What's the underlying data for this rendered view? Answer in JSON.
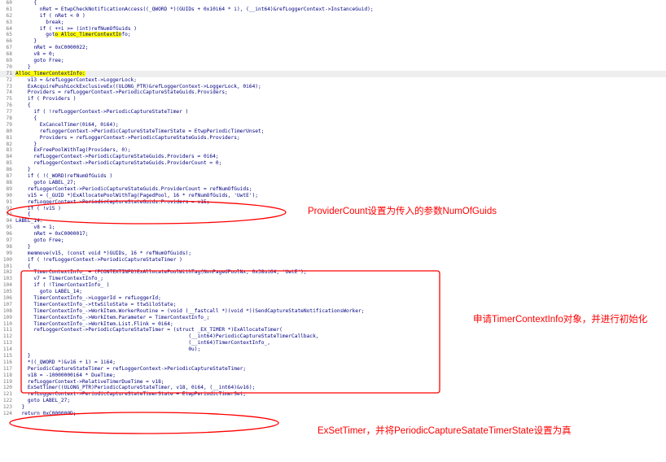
{
  "code_lines": [
    {
      "num": "60",
      "text": "      {"
    },
    {
      "num": "61",
      "text": "        nRet = EtwpCheckNotificationAccess((_QWORD *)(GUIDs + 0x10i64 * i), (__int64)&refLoggerContext->InstanceGuid);"
    },
    {
      "num": "62",
      "text": "        if ( nRet < 0 )"
    },
    {
      "num": "63",
      "text": "          break;"
    },
    {
      "num": "64",
      "text": "        if ( ++i >= (int)refNumOfGuids )"
    },
    {
      "num": "65",
      "text": "          goto Alloc_TimerContextInfo;"
    },
    {
      "num": "66",
      "text": "      }"
    },
    {
      "num": "67",
      "text": "      nRet = 0xC0000022;"
    },
    {
      "num": "68",
      "text": "      v8 = 0;"
    },
    {
      "num": "69",
      "text": "      goto Free;"
    },
    {
      "num": "70",
      "text": "    }"
    },
    {
      "num": "71",
      "text": "Alloc_TimerContextInfo:"
    },
    {
      "num": "72",
      "text": "    v13 = &refLoggerContext->LoggerLock;"
    },
    {
      "num": "73",
      "text": "    ExAcquirePushLockExclusiveEx((ULONG_PTR)&refLoggerContext->LoggerLock, 0i64);"
    },
    {
      "num": "74",
      "text": "    Providers = refLoggerContext->PeriodicCaptureStateGuids.Providers;"
    },
    {
      "num": "75",
      "text": "    if ( Providers )"
    },
    {
      "num": "76",
      "text": "    {"
    },
    {
      "num": "77",
      "text": "      if ( !refLoggerContext->PeriodicCaptureStateTimer )"
    },
    {
      "num": "78",
      "text": "      {"
    },
    {
      "num": "79",
      "text": "        ExCancelTimer(0i64, 0i64);"
    },
    {
      "num": "80",
      "text": "        refLoggerContext->PeriodicCaptureStateTimerState = EtwpPeriodicTimerUnset;"
    },
    {
      "num": "81",
      "text": "        Providers = refLoggerContext->PeriodicCaptureStateGuids.Providers;"
    },
    {
      "num": "82",
      "text": "      }"
    },
    {
      "num": "83",
      "text": "      ExFreePoolWithTag(Providers, 0);"
    },
    {
      "num": "84",
      "text": "      refLoggerContext->PeriodicCaptureStateGuids.Providers = 0i64;"
    },
    {
      "num": "85",
      "text": "      refLoggerContext->PeriodicCaptureStateGuids.ProviderCount = 0;"
    },
    {
      "num": "86",
      "text": "    }"
    },
    {
      "num": "87",
      "text": "    if ( !(_WORD)refNumOfGuids )"
    },
    {
      "num": "88",
      "text": "      goto LABEL_27;"
    },
    {
      "num": "89",
      "text": "    refLoggerContext->PeriodicCaptureStateGuids.ProviderCount = refNumOfGuids;"
    },
    {
      "num": "90",
      "text": "    v15 = (_GUID *)ExAllocatePoolWithTag(PagedPool, 16 * refNumOfGuids, 'UwtE');"
    },
    {
      "num": "91",
      "text": "    refLoggerContext->PeriodicCaptureStateGuids.Providers = v15;"
    },
    {
      "num": "92",
      "text": "    if ( !v15 )"
    },
    {
      "num": "93",
      "text": "    {"
    },
    {
      "num": "94",
      "text": "LABEL_14:"
    },
    {
      "num": "95",
      "text": "      v8 = 1;"
    },
    {
      "num": "96",
      "text": "      nRet = 0xC0000017;"
    },
    {
      "num": "97",
      "text": "      goto Free;"
    },
    {
      "num": "98",
      "text": "    }"
    },
    {
      "num": "99",
      "text": "    memmove(v15, (const void *)GUIDs, 16 * refNumOfGuids);"
    },
    {
      "num": "100",
      "text": "    if ( !refLoggerContext->PeriodicCaptureStateTimer )"
    },
    {
      "num": "101",
      "text": "    {"
    },
    {
      "num": "102",
      "text": "      TimerContextInfo_ = (PCONTEXTINFO)ExAllocatePoolWithTag(NonPagedPoolNx, 0x38ui64, 'UwtE');"
    },
    {
      "num": "103",
      "text": "      v7 = TimerContextInfo_;"
    },
    {
      "num": "104",
      "text": "      if ( !TimerContextInfo_ )"
    },
    {
      "num": "105",
      "text": "        goto LABEL_14;"
    },
    {
      "num": "106",
      "text": "      TimerContextInfo_->LoggerId = refLoggerId;"
    },
    {
      "num": "107",
      "text": "      TimerContextInfo_->ttwSiloState = ttwSiloState;"
    },
    {
      "num": "108",
      "text": "      TimerContextInfo_->WorkItem.WorkerRoutine = (void (__fastcall *)(void *))SendCaptureStateNotificationsWorker;"
    },
    {
      "num": "109",
      "text": "      TimerContextInfo_->WorkItem.Parameter = TimerContextInfo_;"
    },
    {
      "num": "110",
      "text": "      TimerContextInfo_->WorkItem.List.Flink = 0i64;"
    },
    {
      "num": "111",
      "text": "      refLoggerContext->PeriodicCaptureStateTimer = (struct _EX_TIMER *)ExAllocateTimer("
    },
    {
      "num": "112",
      "text": "                                                         (__int64)PeriodicCaptureStateTimerCallback,"
    },
    {
      "num": "113",
      "text": "                                                         (__int64)TimerContextInfo_,"
    },
    {
      "num": "114",
      "text": "                                                         0u);"
    },
    {
      "num": "115",
      "text": "    }"
    },
    {
      "num": "116",
      "text": "    *((_QWORD *)&v16 + 1) = 1i64;"
    },
    {
      "num": "117",
      "text": "    PeriodicCaptureStateTimer = refLoggerContext->PeriodicCaptureStateTimer;"
    },
    {
      "num": "118",
      "text": "    v18 = -10000000i64 * DueTime;"
    },
    {
      "num": "119",
      "text": "    refLoggerContext->RelativeTimerDueTime = v18;"
    },
    {
      "num": "120",
      "text": "    ExSetTimer((ULONG_PTR)PeriodicCaptureStateTimer, v18, 0i64, (__int64)&v16);"
    },
    {
      "num": "121",
      "text": "    refLoggerContext->PeriodicCaptureStateTimerState = EtwpPeriodicTimerSet;"
    },
    {
      "num": "122",
      "text": "    goto LABEL_27;"
    },
    {
      "num": "123",
      "text": "  }"
    },
    {
      "num": "124",
      "text": "  return 0xC000000D;"
    }
  ],
  "annotations": {
    "provider_count": "ProviderCount设置为传入的参数NumOfGuids",
    "timer_context": "申请TimerContextInfo对象，并进行初始化",
    "set_timer": "ExSetTimer，并将PeriodicCaptureSatateTimerState设置为真"
  },
  "colors": {
    "code_text": "#000080",
    "line_number": "#7a7a7a",
    "highlight": "#ffff00",
    "annotation": "#ff0000"
  }
}
